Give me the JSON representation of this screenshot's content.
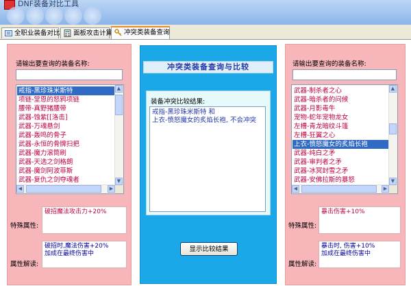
{
  "window": {
    "title": "DNF装备对比工具"
  },
  "tabs": [
    {
      "label": "全职业装备对比",
      "active": false
    },
    {
      "label": "面板攻击计算",
      "active": false
    },
    {
      "label": "冲突类装备查询",
      "active": true
    }
  ],
  "left": {
    "prompt": "请输出要查询的装备名称:",
    "search_value": "",
    "items": [
      {
        "label": "戒指-黑珍珠米斯特",
        "selected": true
      },
      {
        "label": "项链-堂恩的怒鸦项链",
        "selected": false
      },
      {
        "label": "腰带-真野猪腰带",
        "selected": false
      },
      {
        "label": "武器-蚀紫[[洛击]",
        "selected": false
      },
      {
        "label": "武器-万魂悬剑",
        "selected": false
      },
      {
        "label": "武器-轰鸣的骨子",
        "selected": false
      },
      {
        "label": "武器-永恒的骨牌扫把",
        "selected": false
      },
      {
        "label": "武器-魔力滚筒刷",
        "selected": false
      },
      {
        "label": "武器-天选之剑格朗",
        "selected": false
      },
      {
        "label": "武器-魔剑阿波菲斯",
        "selected": false
      },
      {
        "label": "武器-复仇之剑夺魂者",
        "selected": false
      },
      {
        "label": "武器-拉特里尔的遗物",
        "selected": false
      }
    ],
    "special_label": "特殊属性:",
    "special_text": "破招魔法攻击力+20%",
    "explain_label": "属性解读:",
    "explain_text": "破招时,魔法伤害+20%\n加成在最终伤害中"
  },
  "middle": {
    "title": "冲突类装备查询与比较",
    "result_label": "装备冲突比较结果:",
    "result_text": "戒指-黑珍珠米斯特  和\n上衣-愤怒魔女的炙焰长袍, 不会冲突",
    "button_label": "显示比较结果"
  },
  "right": {
    "prompt": "请输出要查询的装备名称:",
    "search_value": "",
    "items": [
      {
        "label": "武器-制杀者之心",
        "selected": false
      },
      {
        "label": "武器-暗杀者的问候",
        "selected": false
      },
      {
        "label": "武器-月影毒牛",
        "selected": false
      },
      {
        "label": "宠物-蛇年宠物龙女",
        "selected": false
      },
      {
        "label": "左槽-青龙暗纹斗篷",
        "selected": false
      },
      {
        "label": "左槽-狂翼之心",
        "selected": false
      },
      {
        "label": "上衣-愤怒魔女的炙焰长袍",
        "selected": true
      },
      {
        "label": "武器-纯白之矛",
        "selected": false
      },
      {
        "label": "武器-审判者之矛",
        "selected": false
      },
      {
        "label": "武器-冰冥封雪之矛",
        "selected": false
      },
      {
        "label": "武器-安佛拉斯的暴怒",
        "selected": false
      },
      {
        "label": "武器-后方之剑",
        "selected": false
      }
    ],
    "special_label": "特殊属性:",
    "special_text": "暴击伤害+10%",
    "explain_label": "属性解读:",
    "explain_text": "暴击时, 伤害+10%\n加成在最终伤害中"
  }
}
